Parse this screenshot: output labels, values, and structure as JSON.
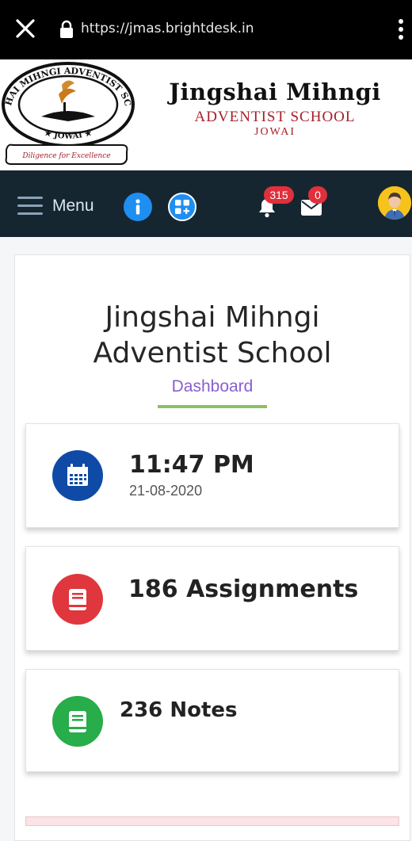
{
  "browser": {
    "url": "https://jmas.brightdesk.in",
    "icons": [
      "close-icon",
      "lock-icon",
      "more-vertical-icon"
    ]
  },
  "banner": {
    "name": "Jingshai Mihngi",
    "subtitle": "ADVENTIST SCHOOL",
    "town": "JOWAI",
    "logo": {
      "ring_text": "JINGSHAI MIHNGI ADVENTIST SCHOOL",
      "bottom_text": "JOWAI",
      "motto": "Diligence for Excellence"
    }
  },
  "navbar": {
    "menu_label": "Menu",
    "notifications_count": "315",
    "messages_count": "0",
    "icons": [
      "menu-icon",
      "info-icon",
      "apps-add-icon",
      "bell-icon",
      "envelope-icon",
      "avatar"
    ]
  },
  "dashboard": {
    "title_line1": "Jingshai Mihngi",
    "title_line2": "Adventist School",
    "subtitle": "Dashboard",
    "cards": [
      {
        "icon": "calendar-icon",
        "value": "11:47 PM",
        "subvalue": "21-08-2020",
        "color": "#0f4aa6"
      },
      {
        "icon": "book-icon",
        "value": "186 Assignments",
        "color": "#e0363d"
      },
      {
        "icon": "notes-icon",
        "value": "236 Notes",
        "color": "#27ad4a"
      }
    ]
  },
  "colors": {
    "navbar": "#162631",
    "accent_blue": "#1f8ef1",
    "badge_red": "#e0303c",
    "underline_green": "#8cc063",
    "subtitle_purple": "#8a5ed1",
    "school_red": "#a6202a"
  }
}
